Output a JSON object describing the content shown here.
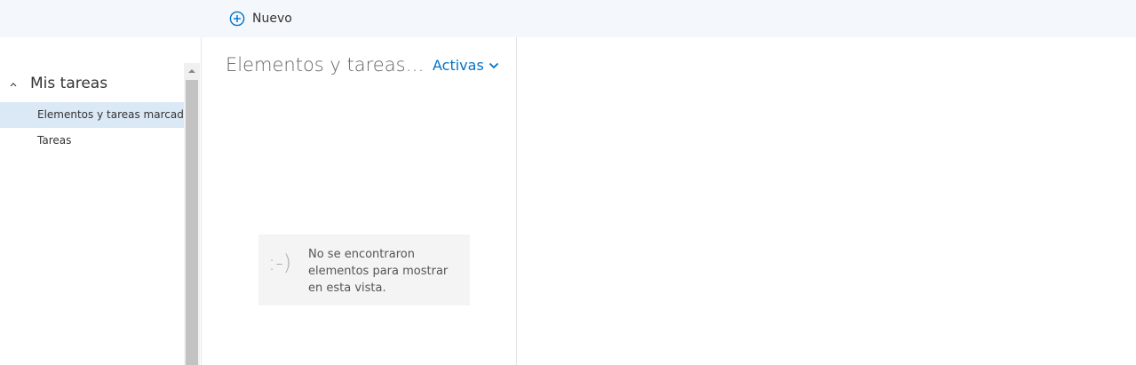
{
  "toolbar": {
    "new_label": "Nuevo",
    "new_icon": "plus-circle-icon",
    "accent": "#0072c6"
  },
  "sidebar": {
    "group_label": "Mis tareas",
    "group_icon": "chevron-up-icon",
    "items": [
      {
        "label": "Elementos y tareas marcados",
        "selected": true
      },
      {
        "label": "Tareas",
        "selected": false
      }
    ]
  },
  "list": {
    "title": "Elementos y tareas marcados",
    "filter_label": "Activas",
    "filter_icon": "chevron-down-icon",
    "empty_face": ":-)",
    "empty_message": "No se encontraron elementos para mostrar en esta vista."
  },
  "colors": {
    "toolbar_bg": "#f4f8fc",
    "selected_bg": "#dbe8f5",
    "accent": "#0072c6"
  }
}
